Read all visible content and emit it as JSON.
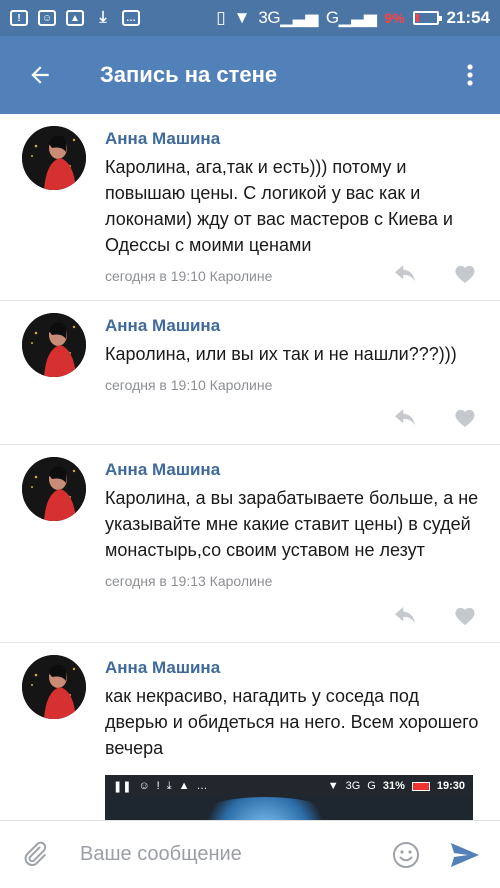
{
  "status_bar": {
    "network": "3G",
    "network2": "G",
    "battery_percent": "9%",
    "time": "21:54"
  },
  "app_bar": {
    "title": "Запись на стене",
    "back_icon": "arrow-left-icon",
    "more_icon": "more-vertical-icon"
  },
  "comments": [
    {
      "author": "Анна Машина",
      "text": "Каролина, ага,так и есть))) потому и повышаю цены. С логикой у вас как и локонами) жду от вас мастеров с Киева и Одессы с моими ценами",
      "meta": "сегодня в 19:10 Каролине"
    },
    {
      "author": "Анна Машина",
      "text": "Каролина, или вы их так и не нашли???)))",
      "meta": "сегодня в 19:10 Каролине"
    },
    {
      "author": "Анна Машина",
      "text": "Каролина, а вы зарабатываете больше, а не указывайте мне какие ставит цены) в судей монастырь,со своим уставом не лезут",
      "meta": "сегодня в 19:13 Каролине"
    },
    {
      "author": "Анна Машина",
      "text": "как некрасиво, нагадить у соседа под дверью и обидеться на него. Всем хорошего вечера",
      "meta": ""
    }
  ],
  "attachment": {
    "network": "3G",
    "network2": "G",
    "battery_percent": "31%",
    "time": "19:30"
  },
  "composer": {
    "placeholder": "Ваше сообщение"
  },
  "colors": {
    "status_bar": "#4a75a5",
    "app_bar": "#5181b8",
    "author": "#3f6a9b",
    "meta": "#8c8f94",
    "battery_low": "#ff4040",
    "send": "#5181b8"
  }
}
